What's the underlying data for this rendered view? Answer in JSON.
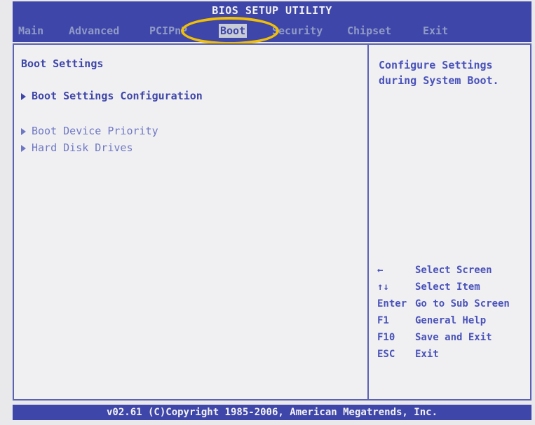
{
  "title": "BIOS SETUP UTILITY",
  "menu": {
    "items": [
      {
        "label": "Main"
      },
      {
        "label": "Advanced"
      },
      {
        "label": "PCIPnP"
      },
      {
        "label": "Boot"
      },
      {
        "label": "Security"
      },
      {
        "label": "Chipset"
      },
      {
        "label": "Exit"
      }
    ]
  },
  "main": {
    "section_title": "Boot Settings",
    "entries": [
      {
        "label": "Boot Settings Configuration"
      },
      {
        "label": "Boot Device Priority"
      },
      {
        "label": "Hard Disk Drives"
      }
    ]
  },
  "help": {
    "line1": "Configure Settings",
    "line2": "during System Boot."
  },
  "keys": [
    {
      "key": "←",
      "action": "Select Screen"
    },
    {
      "key": "↑↓",
      "action": "Select Item"
    },
    {
      "key": "Enter",
      "action": "Go to Sub Screen"
    },
    {
      "key": "F1",
      "action": "General Help"
    },
    {
      "key": "F10",
      "action": "Save and Exit"
    },
    {
      "key": "ESC",
      "action": "Exit"
    }
  ],
  "footer": "v02.61 (C)Copyright 1985-2006, American Megatrends, Inc.",
  "colors": {
    "bar": "#3f46a9",
    "panel": "#f0f0f2",
    "ring": "#f2c000"
  }
}
